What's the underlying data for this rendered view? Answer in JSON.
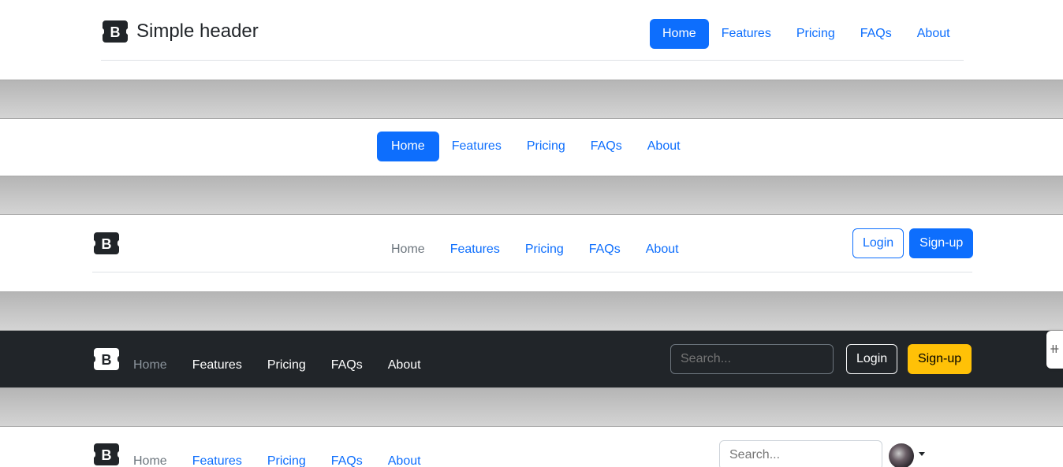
{
  "header1": {
    "brand": "Simple header",
    "nav": [
      "Home",
      "Features",
      "Pricing",
      "FAQs",
      "About"
    ]
  },
  "header2": {
    "nav": [
      "Home",
      "Features",
      "Pricing",
      "FAQs",
      "About"
    ]
  },
  "header3": {
    "nav": [
      "Home",
      "Features",
      "Pricing",
      "FAQs",
      "About"
    ],
    "login": "Login",
    "signup": "Sign-up"
  },
  "header4": {
    "nav": [
      "Home",
      "Features",
      "Pricing",
      "FAQs",
      "About"
    ],
    "search_placeholder": "Search...",
    "login": "Login",
    "signup": "Sign-up"
  },
  "header5": {
    "nav": [
      "Home",
      "Features",
      "Pricing",
      "FAQs",
      "About"
    ],
    "search_placeholder": "Search..."
  },
  "logo_letter": "B",
  "colors": {
    "primary": "#0d6efd",
    "dark": "#212529",
    "warning": "#ffc107",
    "muted": "#6c757d"
  }
}
